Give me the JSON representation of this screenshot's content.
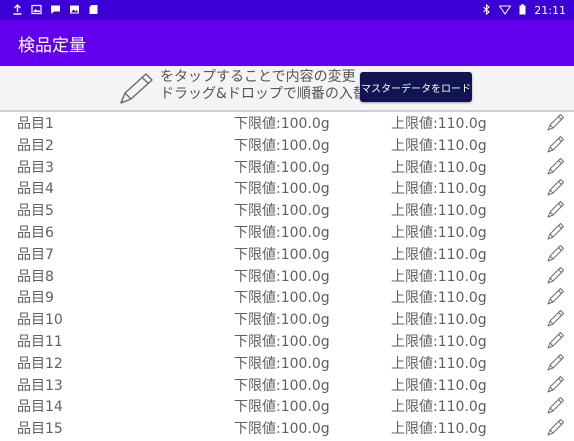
{
  "status_bar": {
    "time": "21:11",
    "left_icons": [
      "upload-icon",
      "image-icon",
      "message-icon",
      "photo-icon",
      "sd-card-icon"
    ],
    "right_icons": [
      "bluetooth-icon",
      "wifi-icon",
      "battery-icon"
    ]
  },
  "app_bar": {
    "title": "検品定量"
  },
  "hint": {
    "line1": "をタップすることで内容の変更",
    "line2": "ドラッグ&ドロップで順番の入替",
    "icon": "pencil-icon"
  },
  "master_button": {
    "label": "マスターデータをロード"
  },
  "items": [
    {
      "name": "品目1",
      "lower": "下限値:100.0g",
      "upper": "上限値:110.0g"
    },
    {
      "name": "品目2",
      "lower": "下限値:100.0g",
      "upper": "上限値:110.0g"
    },
    {
      "name": "品目3",
      "lower": "下限値:100.0g",
      "upper": "上限値:110.0g"
    },
    {
      "name": "品目4",
      "lower": "下限値:100.0g",
      "upper": "上限値:110.0g"
    },
    {
      "name": "品目5",
      "lower": "下限値:100.0g",
      "upper": "上限値:110.0g"
    },
    {
      "name": "品目6",
      "lower": "下限値:100.0g",
      "upper": "上限値:110.0g"
    },
    {
      "name": "品目7",
      "lower": "下限値:100.0g",
      "upper": "上限値:110.0g"
    },
    {
      "name": "品目8",
      "lower": "下限値:100.0g",
      "upper": "上限値:110.0g"
    },
    {
      "name": "品目9",
      "lower": "下限値:100.0g",
      "upper": "上限値:110.0g"
    },
    {
      "name": "品目10",
      "lower": "下限値:100.0g",
      "upper": "上限値:110.0g"
    },
    {
      "name": "品目11",
      "lower": "下限値:100.0g",
      "upper": "上限値:110.0g"
    },
    {
      "name": "品目12",
      "lower": "下限値:100.0g",
      "upper": "上限値:110.0g"
    },
    {
      "name": "品目13",
      "lower": "下限値:100.0g",
      "upper": "上限値:110.0g"
    },
    {
      "name": "品目14",
      "lower": "下限値:100.0g",
      "upper": "上限値:110.0g"
    },
    {
      "name": "品目15",
      "lower": "下限値:100.0g",
      "upper": "上限値:110.0g"
    }
  ],
  "colors": {
    "status_bar": "#3a00d6",
    "app_bar": "#6200ee",
    "button": "#101451",
    "text": "#5f5f5f"
  }
}
